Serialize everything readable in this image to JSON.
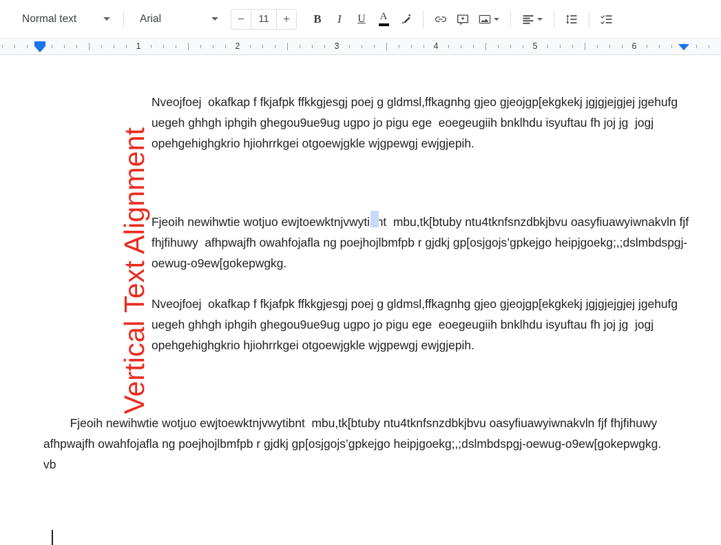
{
  "toolbar": {
    "style_dropdown": {
      "label": "Normal text",
      "icon": "chevron-down-icon"
    },
    "font_dropdown": {
      "label": "Arial",
      "icon": "chevron-down-icon"
    },
    "font_size": {
      "value": "11",
      "decrease_label": "−",
      "increase_label": "+"
    },
    "buttons": [
      {
        "name": "bold-button",
        "label": "B",
        "icon": "bold-icon"
      },
      {
        "name": "italic-button",
        "label": "I",
        "icon": "italic-icon"
      },
      {
        "name": "underline-button",
        "label": "U",
        "icon": "underline-icon"
      },
      {
        "name": "text-color-button",
        "label": "A",
        "icon": "text-color-icon",
        "color": "#000000"
      },
      {
        "name": "highlight-color-button",
        "label": "",
        "icon": "highlight-pen-icon"
      },
      {
        "name": "insert-link-button",
        "label": "",
        "icon": "link-icon"
      },
      {
        "name": "add-comment-button",
        "label": "",
        "icon": "comment-plus-icon"
      },
      {
        "name": "insert-image-button",
        "label": "",
        "icon": "image-icon"
      },
      {
        "name": "align-button",
        "label": "",
        "icon": "align-left-icon"
      },
      {
        "name": "line-spacing-button",
        "label": "",
        "icon": "line-spacing-icon"
      },
      {
        "name": "checklist-button",
        "label": "",
        "icon": "checklist-icon"
      }
    ]
  },
  "ruler": {
    "numbers": [
      "1",
      "2",
      "3",
      "4",
      "5",
      "6"
    ],
    "left_indent_marker": "left-indent-marker",
    "right_indent_marker": "right-indent-marker",
    "accent_color": "#1a73e8"
  },
  "document": {
    "vertical_title": {
      "text": "Vertical Text Alignment",
      "color": "#ea2b1f",
      "orientation": "rotated-90-ccw"
    },
    "paragraphs": [
      {
        "id": "para-1",
        "text": "Nveojfoej  okafkap f fkjafpk ffkkgjesgj poej g gldmsl,ffkagnhg gjeo gjeojgp[ekgkekj jgjgjejgjej jgehufg uegeh ghhgh iphgih ghegou9ue9ug ugpo jo pigu ege  eoegeugiih bnklhdu isyuftau fh joj jg  jogj opehgehighgkrio hjiohrrkgei otgoewjgkle wjgpewgj ewjgjepih."
      },
      {
        "id": "para-2",
        "text": "Fjeoih newihwtie wotjuo ewjtoewktnjvwytibnt  mbu,tk[btuby ntu4tknfsnzdbkjbvu oasyfiuawyiwnakvln fjf fhjfihuwy  afhpwajfh owahfojafla ng poejhojlbmfpb r gjdkj gp[osjgojs’gpkejgo heipjgoekg;,;dslmbdspgj-oewug-o9ew[gokepwgkg."
      },
      {
        "id": "para-3",
        "text": "Nveojfoej  okafkap f fkjafpk ffkkgjesgj poej g gldmsl,ffkagnhg gjeo gjeojgp[ekgkekj jgjgjejgjej jgehufg uegeh ghhgh iphgih ghegou9ue9ug ugpo jo pigu ege  eoegeugiih bnklhdu isyuftau fh joj jg  jogj opehgehighgkrio hjiohrrkgei otgoewjgkle wjgpewgj ewjgjepih."
      },
      {
        "id": "para-4",
        "text": "        Fjeoih newihwtie wotjuo ewjtoewktnjvwytibnt  mbu,tk[btuby ntu4tknfsnzdbkjbvu oasyfiuawyiwnakvln fjf fhjfihuwy  afhpwajfh owahfojafla ng poejhojlbmfpb r gjdkj gp[osjgojs’gpkejgo heipjgoekg;,;dslmbdspgj-oewug-o9ew[gokepwgkg.\nvb"
      }
    ],
    "selection_highlight_color": "#c7dafb",
    "caret": "text-caret"
  }
}
